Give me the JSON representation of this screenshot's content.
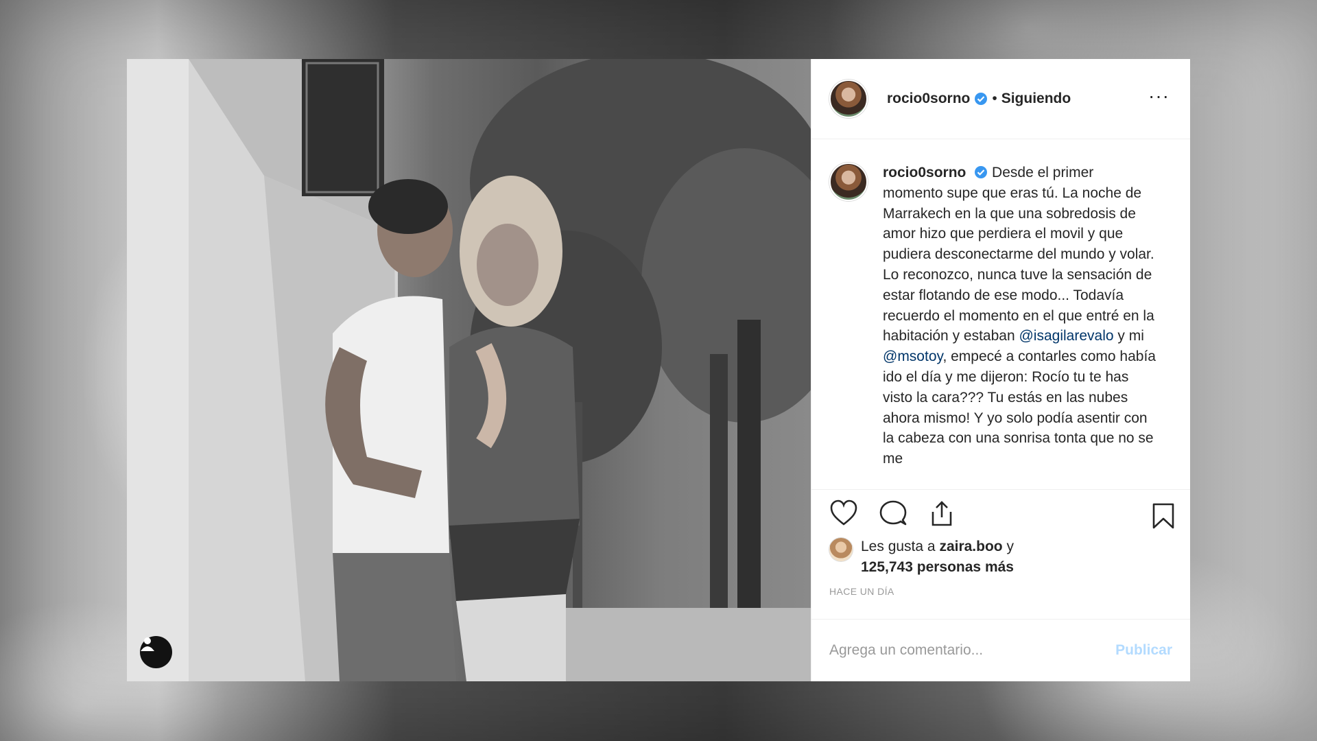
{
  "post": {
    "username": "rocio0sorno",
    "separator": "•",
    "follow_status": "Siguiendo",
    "more_label": "···",
    "caption_name": "rocio0sorno",
    "caption_part1": "Desde el primer momento supe que eras tú. La noche de Marrakech en la que una sobredosis de amor hizo que perdiera el movil y que pudiera desconectarme del mundo y volar. Lo reconozco, nunca tuve la sensación de estar flotando de ese modo... Todavía recuerdo el momento en el que entré en la habitación y estaban",
    "mention1": "@isagilarevalo",
    "caption_part2": "y mi",
    "mention2": "@msotoy",
    "caption_part3": ", empecé a contarles como había ido el día y me dijeron: Rocío tu te has visto la cara??? Tu estás en las nubes ahora mismo! Y yo solo podía asentir con la cabeza con una sonrisa tonta que no se me",
    "likes_prefix": "Les gusta a",
    "likes_user": "zaira.boo",
    "likes_suffix": "y",
    "likes_count": "125,743 personas más",
    "time": "HACE UN DÍA",
    "comment_placeholder": "Agrega un comentario...",
    "post_button": "Publicar"
  },
  "colors": {
    "link": "#003569",
    "verified": "#3897f0",
    "post_button_disabled": "#b3dbff"
  },
  "icons": [
    "user-tag-icon",
    "verified-icon",
    "more-options-icon",
    "heart-icon",
    "comment-icon",
    "share-icon",
    "bookmark-icon"
  ]
}
